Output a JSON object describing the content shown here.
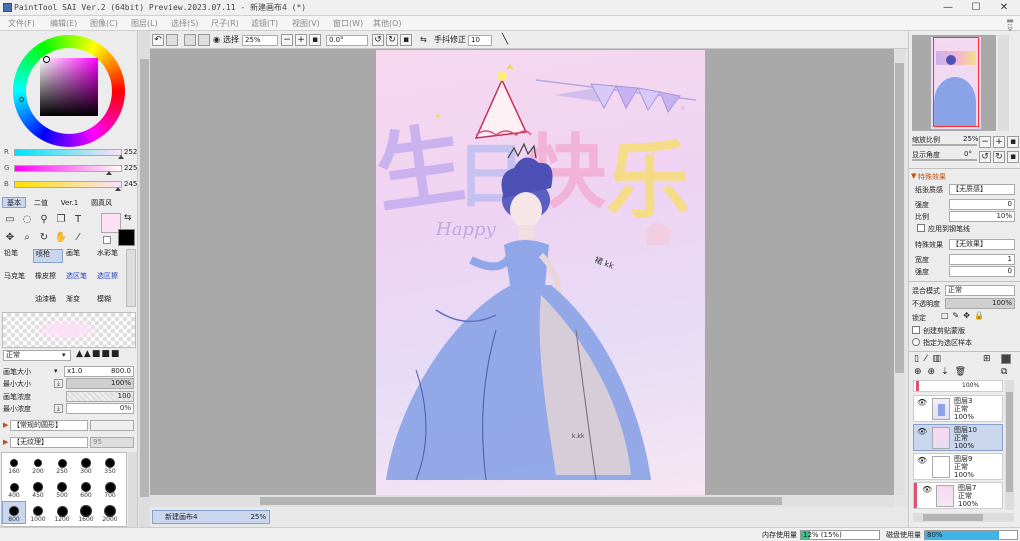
{
  "window": {
    "title": "PaintTool SAI Ver.2 (64bit) Preview.2023.07.11 - 新建画布4 (*)",
    "minimize": "—",
    "maximize": "☐",
    "close": "✕"
  },
  "menu": {
    "items": [
      "文件(F)",
      "编辑(E)",
      "图像(C)",
      "图层(L)",
      "选择(S)",
      "尺子(R)",
      "滤镜(T)",
      "视图(V)",
      "窗口(W)",
      "其他(O)"
    ],
    "mdi_min": "▬",
    "mdi_max": "▫",
    "mdi_close": "✕"
  },
  "color": {
    "r_label": "R",
    "r_value": "252",
    "g_label": "G",
    "g_value": "225",
    "b_label": "B",
    "b_value": "245",
    "r": 252,
    "g": 225,
    "b": 245,
    "primary": "#fce1f5",
    "secondary": "#000000"
  },
  "tool_tabs": [
    "基本",
    "二值",
    "Ver.1",
    "圆真风"
  ],
  "brushes": {
    "row1": [
      "铅笔",
      "喷枪",
      "画笔",
      "水彩笔"
    ],
    "row2": [
      "马克笔",
      "橡皮擦",
      "选区笔",
      "选区擦"
    ],
    "row3": [
      "油漆桶",
      "渐变",
      "模糊"
    ]
  },
  "brush_settings": {
    "blend_mode": "正常",
    "size_label": "画笔大小",
    "size_mult": "x1.0",
    "size_value": "800.0",
    "min_size_label": "最小大小",
    "min_size_value": "100%",
    "density_label": "画笔浓度",
    "density_value": "100",
    "min_density_label": "最小浓度",
    "min_density_value": "0%",
    "shape": "【常规的圆形】",
    "texture": "【无纹理】",
    "texture_strength": "95"
  },
  "brush_sizes": [
    "160",
    "200",
    "250",
    "300",
    "350",
    "400",
    "450",
    "500",
    "600",
    "700",
    "800",
    "1000",
    "1200",
    "1600",
    "2000"
  ],
  "toolbar": {
    "selection_label": "选择",
    "zoom": "25%",
    "angle": "0.0°",
    "stabilizer_label": "手抖修正",
    "stabilizer_value": "10",
    "minus": "−",
    "plus": "+"
  },
  "document": {
    "tab_name": "新建画布4",
    "tab_zoom": "25%"
  },
  "artwork": {
    "title_chars": [
      "生",
      "日",
      "快",
      "乐"
    ],
    "subtitle": "Happy",
    "signature_1": "裙 kk",
    "signature_2": "k.kk"
  },
  "navigator": {
    "zoom_label": "缩放比例",
    "zoom_value": "25%",
    "angle_label": "显示角度",
    "angle_value": "0°"
  },
  "effects": {
    "section_title": "特殊效果",
    "paper_label": "纸张质感",
    "paper_value": "【无质感】",
    "strength_label": "强度",
    "strength_value": "0",
    "scale_label": "比例",
    "scale_value": "10%",
    "apply_brush_label": "应用到钢笔线",
    "effect_label": "特殊效果",
    "effect_value": "【无效果】",
    "width_label": "宽度",
    "width_value": "1",
    "strength2_label": "强度",
    "strength2_value": "0"
  },
  "layer_props": {
    "blend_label": "混合模式",
    "blend_value": "正常",
    "opacity_label": "不透明度",
    "opacity_value": "100%",
    "lock_label": "锁定",
    "clip_label": "创建剪贴蒙版",
    "source_label": "指定为选区样本"
  },
  "layers": [
    {
      "name": "图层3",
      "mode": "正常",
      "opacity": "100%",
      "selected": false
    },
    {
      "name": "图层10",
      "mode": "正常",
      "opacity": "100%",
      "selected": true
    },
    {
      "name": "图层9",
      "mode": "正常",
      "opacity": "100%",
      "selected": false
    },
    {
      "name": "图层7",
      "mode": "正常",
      "opacity": "100%",
      "selected": false
    }
  ],
  "layer_top_partial": "100%",
  "status": {
    "memory_label": "内存使用量",
    "memory_value": "12% (15%)",
    "memory_fill": 0.12,
    "disk_label": "磁盘使用量",
    "disk_value": "80%",
    "disk_fill": 0.8
  }
}
